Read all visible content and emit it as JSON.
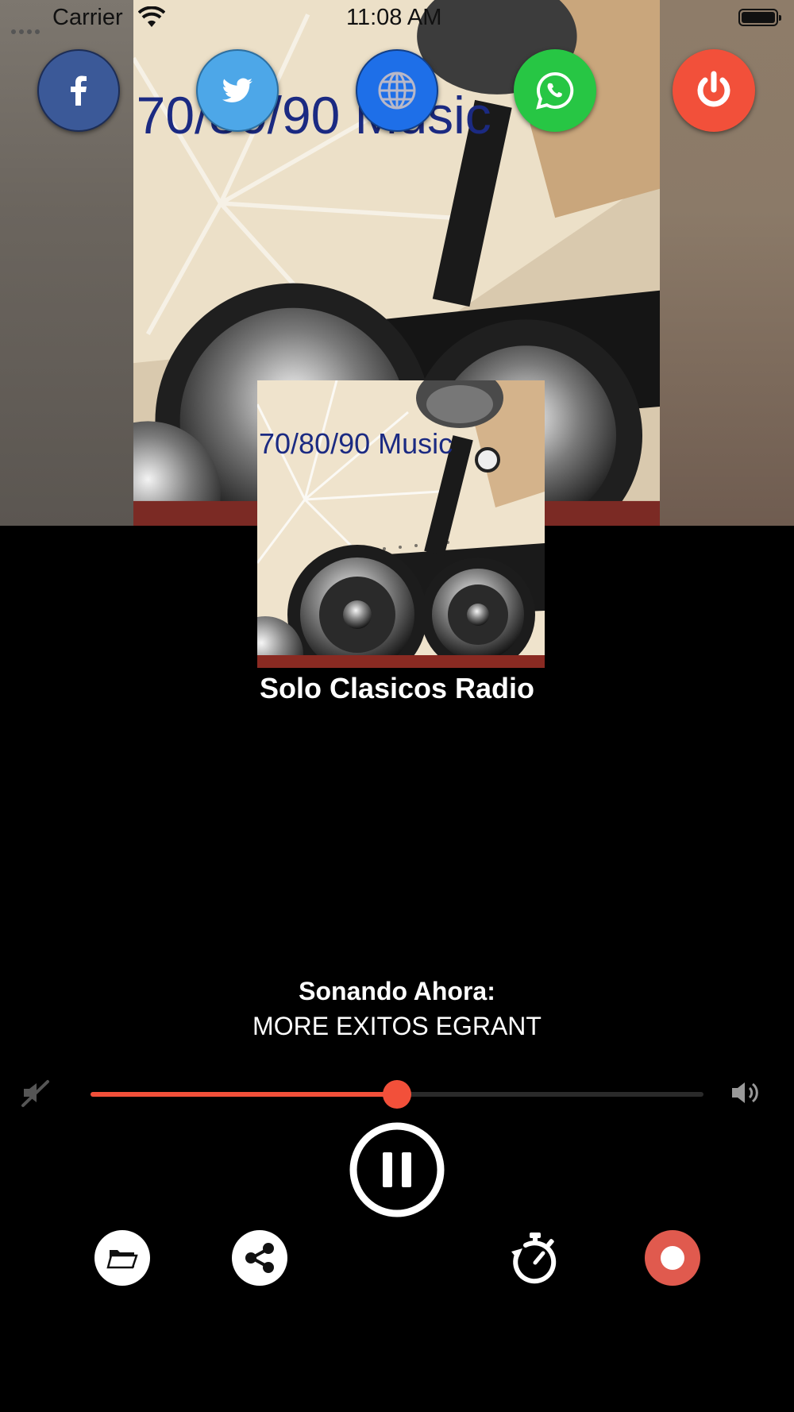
{
  "status_bar": {
    "carrier": "Carrier",
    "time": "11:08 AM"
  },
  "social_buttons": [
    {
      "name": "facebook",
      "icon": "facebook-icon",
      "color": "#3b5998"
    },
    {
      "name": "twitter",
      "icon": "twitter-icon",
      "color": "#4da7e8"
    },
    {
      "name": "website",
      "icon": "globe-icon",
      "color": "#1e6fe8"
    },
    {
      "name": "whatsapp",
      "icon": "whatsapp-icon",
      "color": "#27c644"
    },
    {
      "name": "power",
      "icon": "power-icon",
      "color": "#f2503a"
    }
  ],
  "artwork": {
    "caption": "70/80/90 Music"
  },
  "station": {
    "name": "Solo Clasicos Radio"
  },
  "now_playing": {
    "label": "Sonando Ahora:",
    "song": "MORE EXITOS EGRANT"
  },
  "volume": {
    "level": 0.5,
    "accent": "#f2503a",
    "min_icon": "volume-mute-icon",
    "max_icon": "volume-up-icon"
  },
  "controls": {
    "play_state": "pause-icon",
    "buttons": [
      "folder-icon",
      "share-icon",
      "timer-icon",
      "record-icon"
    ]
  }
}
